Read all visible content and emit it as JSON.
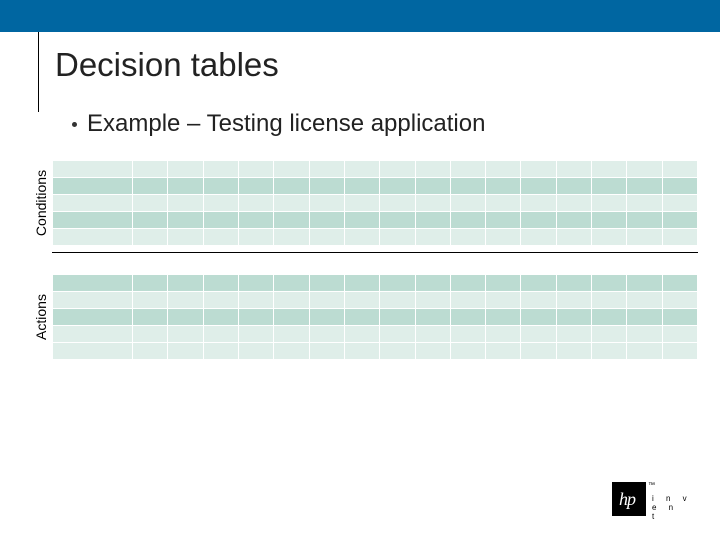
{
  "slide": {
    "title": "Decision tables",
    "bullet": "Example – Testing license application"
  },
  "sections": {
    "conditions_label": "Conditions",
    "actions_label": "Actions"
  },
  "table": {
    "condition_rows": 5,
    "action_rows": 5,
    "rule_columns": 16,
    "condition_dark_rows": [
      1,
      3
    ],
    "action_dark_rows": [
      0,
      2
    ]
  },
  "branding": {
    "logo_text": "hp",
    "logo_sub": "i n v e n t",
    "tm": "™"
  },
  "colors": {
    "accent_blue": "#0066a1",
    "cell_light": "#dfeee9",
    "cell_dark": "#bcdcd2"
  }
}
